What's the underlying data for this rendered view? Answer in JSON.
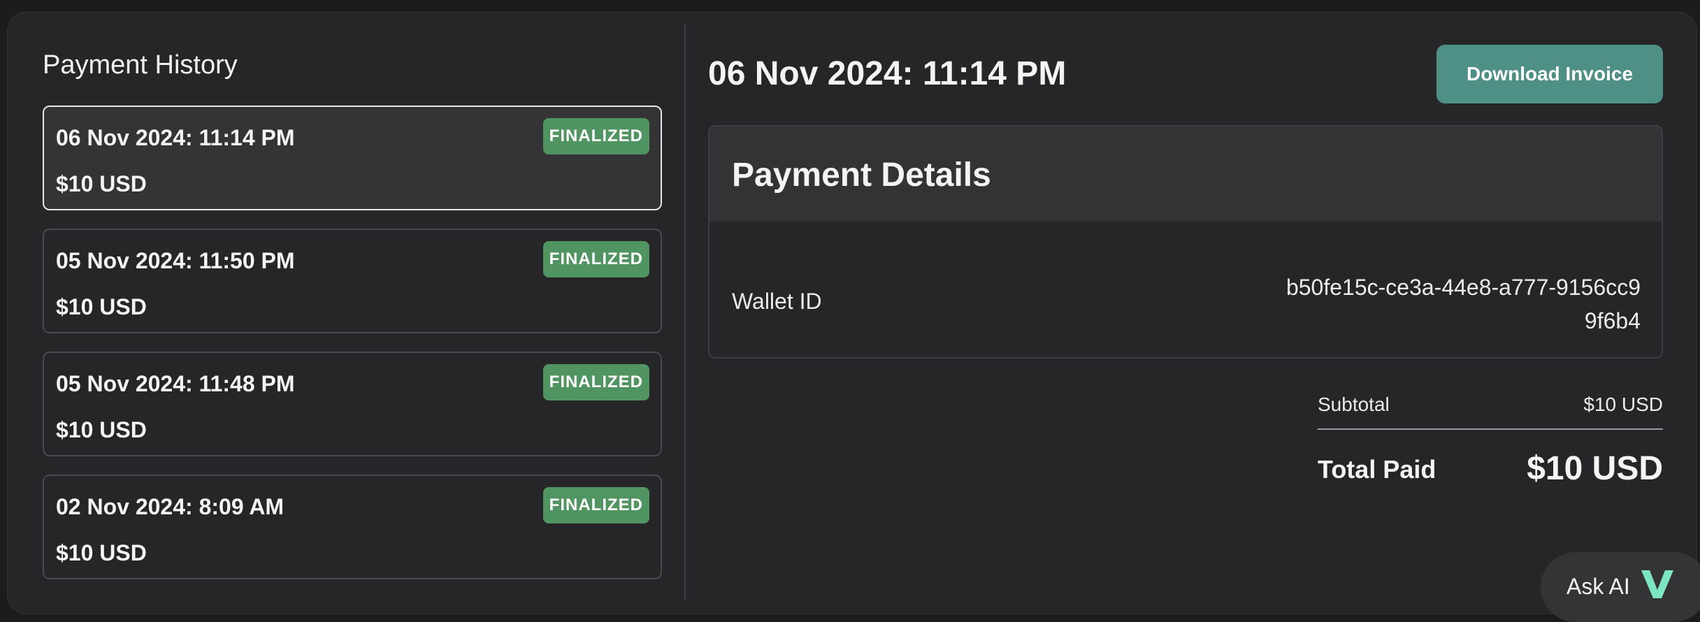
{
  "history": {
    "title": "Payment History",
    "payments": [
      {
        "date": "06 Nov 2024: 11:14 PM",
        "amount": "$10 USD",
        "status": "FINALIZED"
      },
      {
        "date": "05 Nov 2024: 11:50 PM",
        "amount": "$10 USD",
        "status": "FINALIZED"
      },
      {
        "date": "05 Nov 2024: 11:48 PM",
        "amount": "$10 USD",
        "status": "FINALIZED"
      },
      {
        "date": "02 Nov 2024: 8:09 AM",
        "amount": "$10 USD",
        "status": "FINALIZED"
      }
    ]
  },
  "detail": {
    "title": "06 Nov 2024: 11:14 PM",
    "download_label": "Download Invoice",
    "card_title": "Payment Details",
    "wallet_label": "Wallet ID",
    "wallet_id": "b50fe15c-ce3a-44e8-a777-9156cc99f6b4",
    "subtotal_label": "Subtotal",
    "subtotal_value": "$10 USD",
    "total_label": "Total Paid",
    "total_value": "$10 USD"
  },
  "ask_ai": {
    "label": "Ask AI",
    "icon": "v-logo-icon"
  },
  "colors": {
    "background": "#262628",
    "badge_green": "#4f9461",
    "button_teal": "#4e8f86",
    "ai_logo_mint": "#7be6c0"
  }
}
